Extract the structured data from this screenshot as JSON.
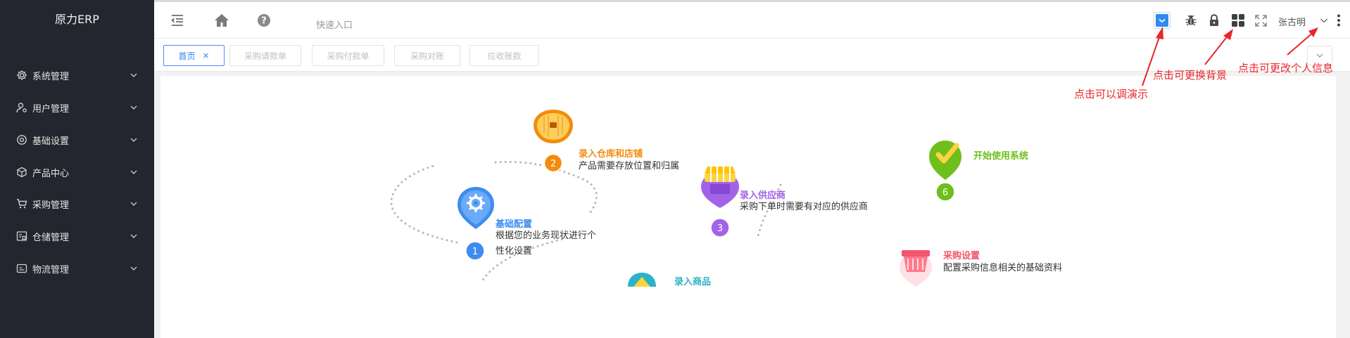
{
  "app": {
    "title": "原力ERP"
  },
  "sidebar": {
    "items": [
      {
        "label": "系统管理",
        "icon": "gear-icon"
      },
      {
        "label": "用户管理",
        "icon": "user-settings-icon"
      },
      {
        "label": "基础设置",
        "icon": "cog-circle-icon"
      },
      {
        "label": "产品中心",
        "icon": "cube-icon"
      },
      {
        "label": "采购管理",
        "icon": "cart-icon"
      },
      {
        "label": "仓储管理",
        "icon": "warehouse-icon"
      },
      {
        "label": "物流管理",
        "icon": "logistics-icon"
      }
    ]
  },
  "header": {
    "quick_entry": "快速入口",
    "user_name": "张古明"
  },
  "tabs": [
    {
      "label": "首页",
      "active": true,
      "close": "×"
    },
    {
      "label": "采购请款单",
      "active": false
    },
    {
      "label": "采购付款单",
      "active": false
    },
    {
      "label": "采购对账",
      "active": false
    },
    {
      "label": "应收账款",
      "active": false
    }
  ],
  "steps": [
    {
      "num": "1",
      "title": "基础配置",
      "desc1": "根据您的业务现状进行个",
      "desc2": "性化设置",
      "color": "#3f8cf0"
    },
    {
      "num": "2",
      "title": "录入仓库和店铺",
      "desc1": "产品需要存放位置和归属",
      "color": "#f28c0c"
    },
    {
      "num": "3",
      "title": "录入供应商",
      "desc1": "采购下单时需要有对应的供应商",
      "color": "#a363e8"
    },
    {
      "num": "",
      "title": "录入商品",
      "color": "#2bb3c8"
    },
    {
      "num": "",
      "title": "采购设置",
      "desc1": "配置采购信息相关的基础资料",
      "color": "#f2566b"
    },
    {
      "num": "6",
      "title": "开始使用系统",
      "color": "#6fbf1c"
    }
  ],
  "annotations": {
    "demo": "点击可以调演示",
    "background": "点击可更换背景",
    "profile": "点击可更改个人信息"
  },
  "colors": {
    "sidebar_bg": "#23262e",
    "accent": "#2f80ed",
    "annotation": "#e8262b"
  }
}
